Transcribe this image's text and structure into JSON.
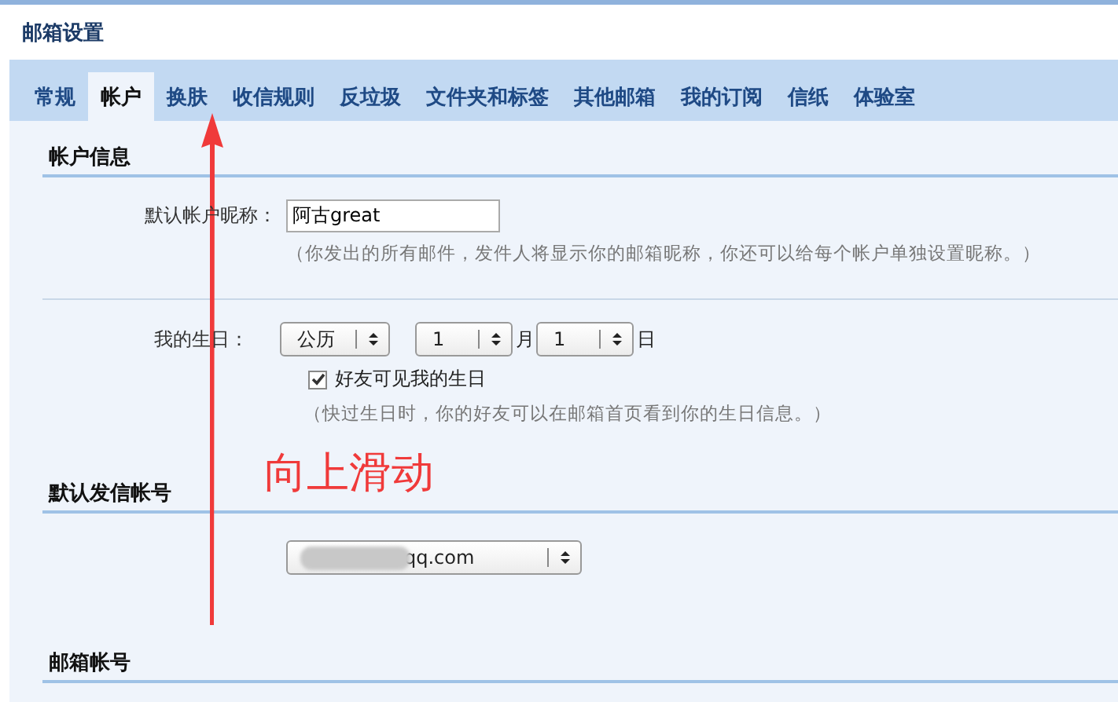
{
  "window": {
    "title": "邮箱设置"
  },
  "tabs": [
    {
      "label": "常规",
      "selected": false
    },
    {
      "label": "帐户",
      "selected": true
    },
    {
      "label": "换肤",
      "selected": false
    },
    {
      "label": "收信规则",
      "selected": false
    },
    {
      "label": "反垃圾",
      "selected": false
    },
    {
      "label": "文件夹和标签",
      "selected": false
    },
    {
      "label": "其他邮箱",
      "selected": false
    },
    {
      "label": "我的订阅",
      "selected": false
    },
    {
      "label": "信纸",
      "selected": false
    },
    {
      "label": "体验室",
      "selected": false
    }
  ],
  "account_info": {
    "heading": "帐户信息",
    "nickname_label": "默认帐户昵称：",
    "nickname_value": "阿古great",
    "nickname_hint": "（你发出的所有邮件，发件人将显示你的邮箱昵称，你还可以给每个帐户单独设置昵称。）",
    "birthday_label": "我的生日：",
    "calendar": "公历",
    "month": "1",
    "month_unit": "月",
    "day": "1",
    "day_unit": "日",
    "friends_visible": {
      "label": "好友可见我的生日",
      "checked": true
    },
    "birthday_hint": "（快过生日时，你的好友可以在邮箱首页看到你的生日信息。）"
  },
  "default_sender": {
    "heading": "默认发信帐号",
    "account": "qq.com"
  },
  "mail_accounts": {
    "heading": "邮箱帐号"
  },
  "annotation": {
    "text": "向上滑动"
  }
}
